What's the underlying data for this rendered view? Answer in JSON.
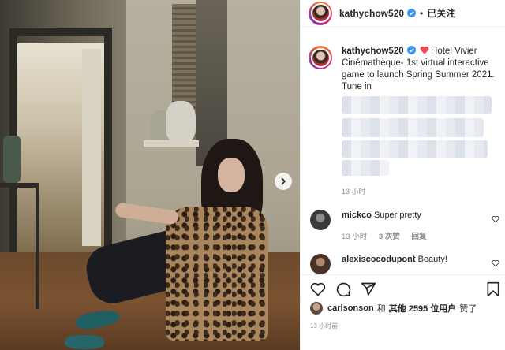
{
  "post": {
    "username": "kathychow520",
    "follow_label": "已关注",
    "separator": "•",
    "caption_user": "kathychow520",
    "caption_text": "Hotel Vivier Cinémathèque- 1st virtual interactive game to launch Spring Summer 2021. Tune in",
    "time": "13 小时"
  },
  "comments": [
    {
      "user": "mickco",
      "text": "Super pretty",
      "time": "13 小时",
      "likes": "3 次赞",
      "reply": "回复"
    },
    {
      "user": "alexiscocodupont",
      "text": "Beauty!"
    }
  ],
  "likes": {
    "user": "carlsonson",
    "and": "和",
    "others": "其他 2595 位用户",
    "suffix": "赞了"
  },
  "timestamp": "13 小时前",
  "colors": {
    "verified": "#3897f0",
    "heart": "#ed4956",
    "muted": "#8e8e8e"
  },
  "icons": [
    "verified-icon",
    "heart-icon",
    "comment-icon",
    "share-icon",
    "bookmark-icon",
    "chevron-right-icon"
  ]
}
